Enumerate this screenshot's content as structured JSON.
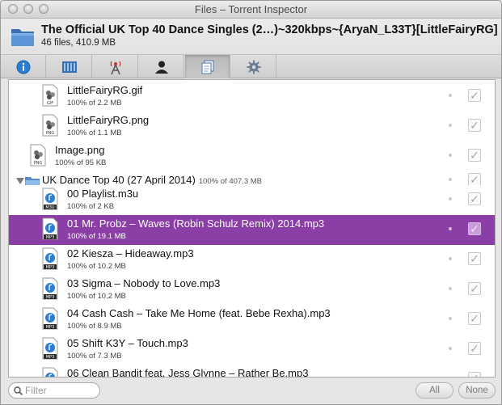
{
  "window": {
    "title": "Files – Torrent Inspector"
  },
  "torrent": {
    "name": "The Official UK Top 40 Dance Singles (2…)~320kbps~{AryaN_L33T}[LittleFairyRG]",
    "summary": "46 files, 410.9 MB"
  },
  "tabs": [
    {
      "icon": "info-icon",
      "active": false
    },
    {
      "icon": "pieces-icon",
      "active": false
    },
    {
      "icon": "trackers-icon",
      "active": false
    },
    {
      "icon": "peers-icon",
      "active": false
    },
    {
      "icon": "files-icon",
      "active": true
    },
    {
      "icon": "gear-icon",
      "active": false
    }
  ],
  "files": [
    {
      "name": "LittleFairyRG.gif",
      "sub": "100% of 2.2 MB",
      "type": "GIF"
    },
    {
      "name": "LittleFairyRG.png",
      "sub": "100% of 1.1 MB",
      "type": "PNG"
    },
    {
      "name": "Image.png",
      "sub": "100% of 95 KB",
      "type": "PNG"
    },
    {
      "name": "UK Dance Top 40 (27 April 2014)",
      "sub": "100% of 407.3 MB",
      "type": "folder"
    },
    {
      "name": "00 Playlist.m3u",
      "sub": "100% of 2 KB",
      "type": "M3U"
    },
    {
      "name": "01 Mr. Probz – Waves (Robin Schulz Remix) 2014.mp3",
      "sub": "100% of 19.1 MB",
      "type": "MP3",
      "selected": true
    },
    {
      "name": "02 Kiesza – Hideaway.mp3",
      "sub": "100% of 10.2 MB",
      "type": "MP3"
    },
    {
      "name": "03 Sigma – Nobody to Love.mp3",
      "sub": "100% of 10.2 MB",
      "type": "MP3"
    },
    {
      "name": "04 Cash Cash – Take Me Home (feat. Bebe Rexha).mp3",
      "sub": "100% of 8.9 MB",
      "type": "MP3"
    },
    {
      "name": "05 Shift K3Y – Touch.mp3",
      "sub": "100% of 7.3 MB",
      "type": "MP3"
    },
    {
      "name": "06 Clean Bandit feat. Jess Glynne – Rather Be.mp3",
      "sub": "",
      "type": "MP3"
    }
  ],
  "bottom": {
    "filter_placeholder": "Filter",
    "all_label": "All",
    "none_label": "None"
  },
  "colors": {
    "selection": "#8b3fa6",
    "accent_blue": "#2a7fd4"
  }
}
